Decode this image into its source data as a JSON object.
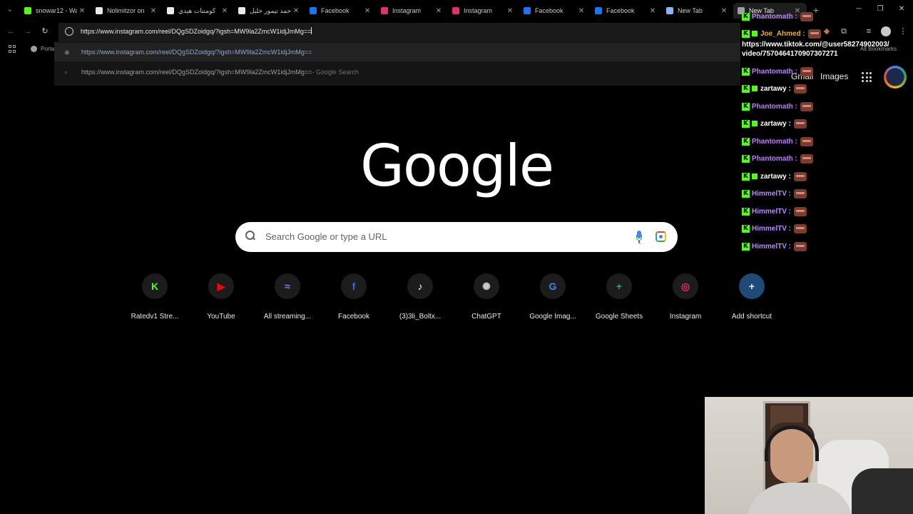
{
  "tabs": [
    {
      "title": "snowar12 - Wa",
      "color": "#53fc18",
      "active": false
    },
    {
      "title": "Nolimitzor on",
      "color": "#e8eaed",
      "active": false
    },
    {
      "title": "كومنتات هيدي",
      "color": "#e8eaed",
      "active": false
    },
    {
      "title": "أحمد تيمور خليل",
      "color": "#e8eaed",
      "active": false
    },
    {
      "title": "Facebook",
      "color": "#1877f2",
      "active": false
    },
    {
      "title": "Instagram",
      "color": "#e1306c",
      "active": false
    },
    {
      "title": "Instagram",
      "color": "#e1306c",
      "active": false
    },
    {
      "title": "Facebook",
      "color": "#1877f2",
      "active": false
    },
    {
      "title": "Facebook",
      "color": "#1877f2",
      "active": false
    },
    {
      "title": "New Tab",
      "color": "#8ab4f8",
      "active": false
    },
    {
      "title": "New Tab",
      "color": "#9aa0a6",
      "active": true
    }
  ],
  "toolbar": {
    "url": "https://www.instagram.com/reel/DQgSDZoidgq/?igsh=MW9la2ZmcW1idjJmMg=="
  },
  "bookmarks": {
    "item": "PortableApps.com",
    "all_bookmarks": "All Bookmarks"
  },
  "dropdown": {
    "suggestion_1": "https://www.instagram.com/reel/DQgSDZoidgq/?igsh=MW9la2ZmcW1idjJmMg==",
    "suggestion_2": "https://www.instagram.com/reel/DQgSDZoidgq/?igsh=MW9la2ZmcW1idjJmMg==",
    "suggestion_2_suffix": " - Google Search"
  },
  "ntp": {
    "gmail": "Gmail",
    "images": "Images",
    "logo": "Google",
    "search_placeholder": "Search Google or type a URL",
    "shortcuts": [
      {
        "label": "Ratedv1 Stre...",
        "glyph": "K",
        "color": "#53fc18"
      },
      {
        "label": "YouTube",
        "glyph": "▶",
        "color": "#ff0000"
      },
      {
        "label": "All streaming...",
        "glyph": "≈",
        "color": "#8e7cf6"
      },
      {
        "label": "Facebook",
        "glyph": "f",
        "color": "#1877f2"
      },
      {
        "label": "(3)3li_Boltx...",
        "glyph": "♪",
        "color": "#ffffff"
      },
      {
        "label": "ChatGPT",
        "glyph": "✺",
        "color": "#c8cacd"
      },
      {
        "label": "Google Imag...",
        "glyph": "G",
        "color": "#4285f4"
      },
      {
        "label": "Google Sheets",
        "glyph": "+",
        "color": "#34a853"
      },
      {
        "label": "Instagram",
        "glyph": "◎",
        "color": "#e1306c"
      },
      {
        "label": "Add shortcut",
        "glyph": "+",
        "color": "#e8eaed"
      }
    ]
  },
  "overlay": {
    "chat": [
      {
        "user": "Phantomath",
        "color": "#c07cff",
        "badge": false
      },
      {
        "user": "Joe_Ahmed",
        "color": "#ffb000",
        "badge": true
      },
      {
        "user": "Phantomath",
        "color": "#c07cff",
        "badge": false
      },
      {
        "user": "zartawy",
        "color": "#ffffff",
        "badge": true
      },
      {
        "user": "Phantomath",
        "color": "#c07cff",
        "badge": false
      },
      {
        "user": "zartawy",
        "color": "#ffffff",
        "badge": true
      },
      {
        "user": "Phantomath",
        "color": "#c07cff",
        "badge": false
      },
      {
        "user": "Phantomath",
        "color": "#c07cff",
        "badge": false
      },
      {
        "user": "zartawy",
        "color": "#ffffff",
        "badge": true
      },
      {
        "user": "HimmelTV",
        "color": "#b58cff",
        "badge": false
      },
      {
        "user": "HimmelTV",
        "color": "#b58cff",
        "badge": false
      },
      {
        "user": "HimmelTV",
        "color": "#b58cff",
        "badge": false
      },
      {
        "user": "HimmelTV",
        "color": "#b58cff",
        "badge": false
      }
    ],
    "tiktok_link_line1": "https://www.tiktok.com/@user58274902003/",
    "tiktok_link_line2": "video/7570464170907307271"
  },
  "colors": {
    "kick_green": "#53fc18",
    "background": "#000000"
  }
}
